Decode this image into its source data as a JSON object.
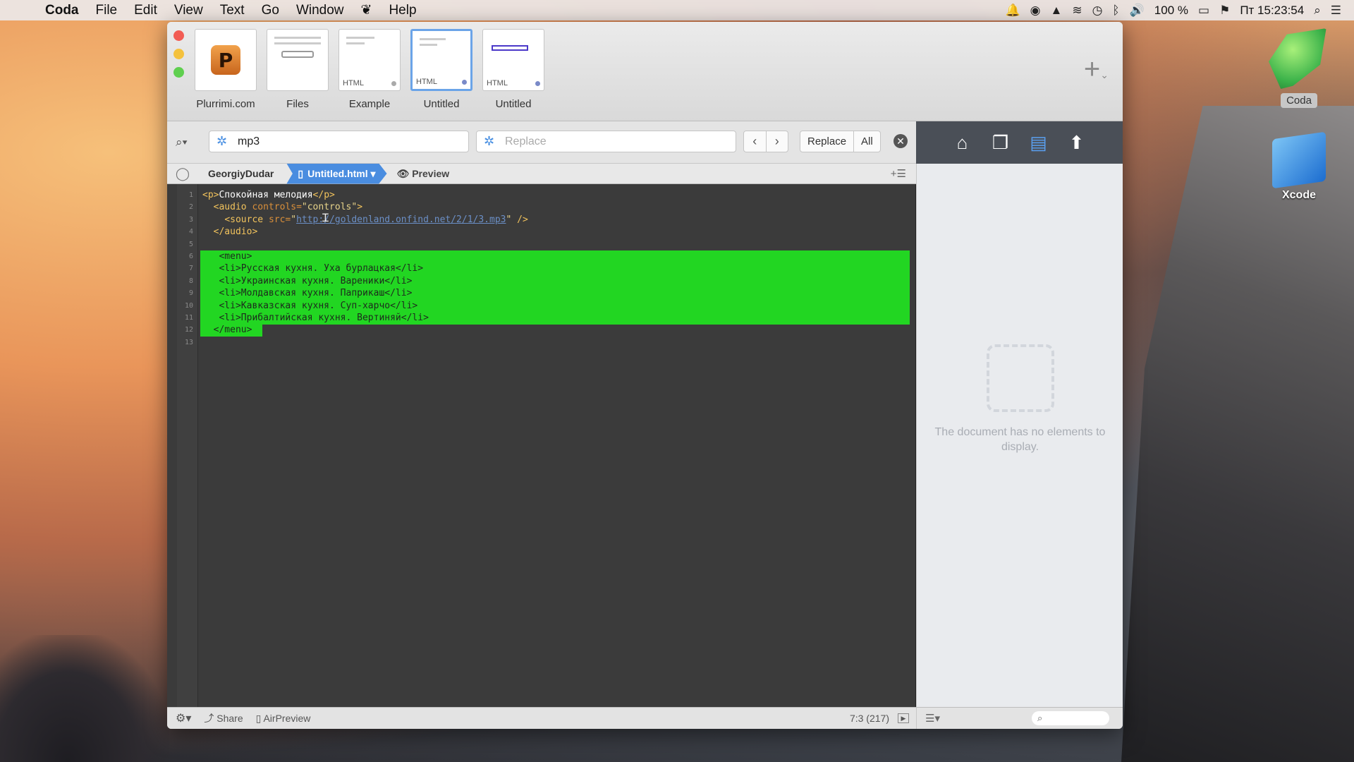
{
  "menubar": {
    "apple": "",
    "app_name": "Coda",
    "items": [
      "File",
      "Edit",
      "View",
      "Text",
      "Go",
      "Window",
      "Help"
    ],
    "battery": "100 %",
    "clock": "Пт 15:23:54"
  },
  "sites": [
    {
      "label": "Plurrimi.com",
      "type": ""
    },
    {
      "label": "Files",
      "type": ""
    },
    {
      "label": "Example",
      "type": "HTML"
    },
    {
      "label": "Untitled",
      "type": "HTML"
    },
    {
      "label": "Untitled",
      "type": "HTML"
    }
  ],
  "sites_extra": {
    "badge_letter": "P"
  },
  "find": {
    "search_value": "mp3",
    "replace_placeholder": "Replace",
    "replace_label": "Replace",
    "all_label": "All"
  },
  "path": {
    "site": "GeorgiyDudar",
    "file": "Untitled.html",
    "preview": "Preview"
  },
  "editor": {
    "line_numbers": [
      "1",
      "2",
      "3",
      "4",
      "5",
      "6",
      "7",
      "8",
      "9",
      "10",
      "11",
      "12",
      "13"
    ],
    "lines": [
      {
        "parts": [
          [
            "tag",
            "<p>"
          ],
          [
            "txt",
            "Спокойная мелодия"
          ],
          [
            "tag",
            "</p>"
          ]
        ]
      },
      {
        "parts": [
          [
            "txt",
            "  "
          ],
          [
            "tag",
            "<audio "
          ],
          [
            "attr",
            "controls="
          ],
          [
            "str",
            "\"controls\""
          ],
          [
            "tag",
            ">"
          ]
        ]
      },
      {
        "parts": [
          [
            "txt",
            "    "
          ],
          [
            "tag",
            "<source "
          ],
          [
            "attr",
            "src="
          ],
          [
            "str",
            "\""
          ],
          [
            "url",
            "http://goldenland.onfind.net/2/1/3.mp3"
          ],
          [
            "str",
            "\""
          ],
          [
            "tag",
            " />"
          ]
        ]
      },
      {
        "parts": [
          [
            "txt",
            "  "
          ],
          [
            "tag",
            "</audio>"
          ]
        ]
      },
      {
        "parts": []
      },
      {
        "parts": []
      }
    ],
    "highlighted_lines": [
      "   <menu>",
      "   <li>Русская кухня. Уха бурлацкая</li>",
      "   <li>Украинская кухня. Вареники</li>",
      "   <li>Молдавская кухня. Паприкаш</li>",
      "   <li>Кавказская кухня. Суп-харчо</li>",
      "   <li>Прибалтийская кухня. Вертиняй</li>",
      "  </menu>"
    ]
  },
  "right_panel": {
    "empty_message": "The document has no elements to display."
  },
  "status": {
    "share": "Share",
    "airpreview": "AirPreview",
    "cursor_pos": "7:3 (217)"
  },
  "desktop": {
    "coda_label": "Coda",
    "xcode_label": "Xcode"
  },
  "colors": {
    "highlight": "#22d622",
    "editor_bg": "#3b3b3b",
    "active_crumb": "#4a8de0"
  }
}
